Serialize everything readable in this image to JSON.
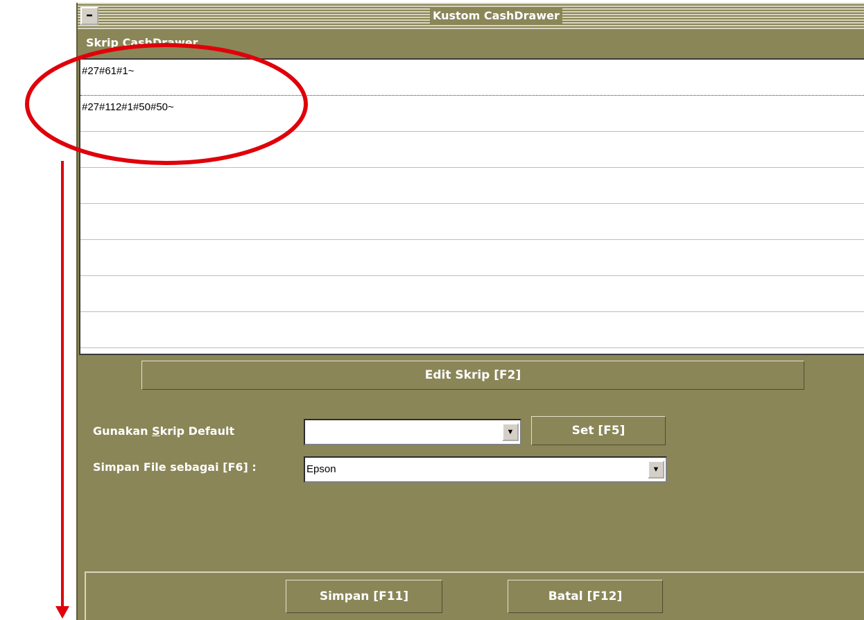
{
  "window": {
    "title": "Kustom CashDrawer",
    "minimize_label": "–"
  },
  "script_section": {
    "label": "Skrip CashDrawer",
    "rows": [
      "#27#61#1~",
      "#27#112#1#50#50~",
      "",
      "",
      "",
      "",
      "",
      ""
    ]
  },
  "buttons": {
    "edit": "Edit Skrip [F2]",
    "set": "Set [F5]",
    "save": "Simpan [F11]",
    "cancel": "Batal [F12]"
  },
  "form": {
    "default_label_prefix": "Gunakan ",
    "default_label_accel": "S",
    "default_label_suffix": "krip Default",
    "default_value": "",
    "save_label": "Simpan File sebagai [F6] :",
    "save_value": "Epson",
    "dropdown_icon": "▼"
  },
  "colors": {
    "window_bg": "#8a8658",
    "annotation": "#e0000a"
  }
}
